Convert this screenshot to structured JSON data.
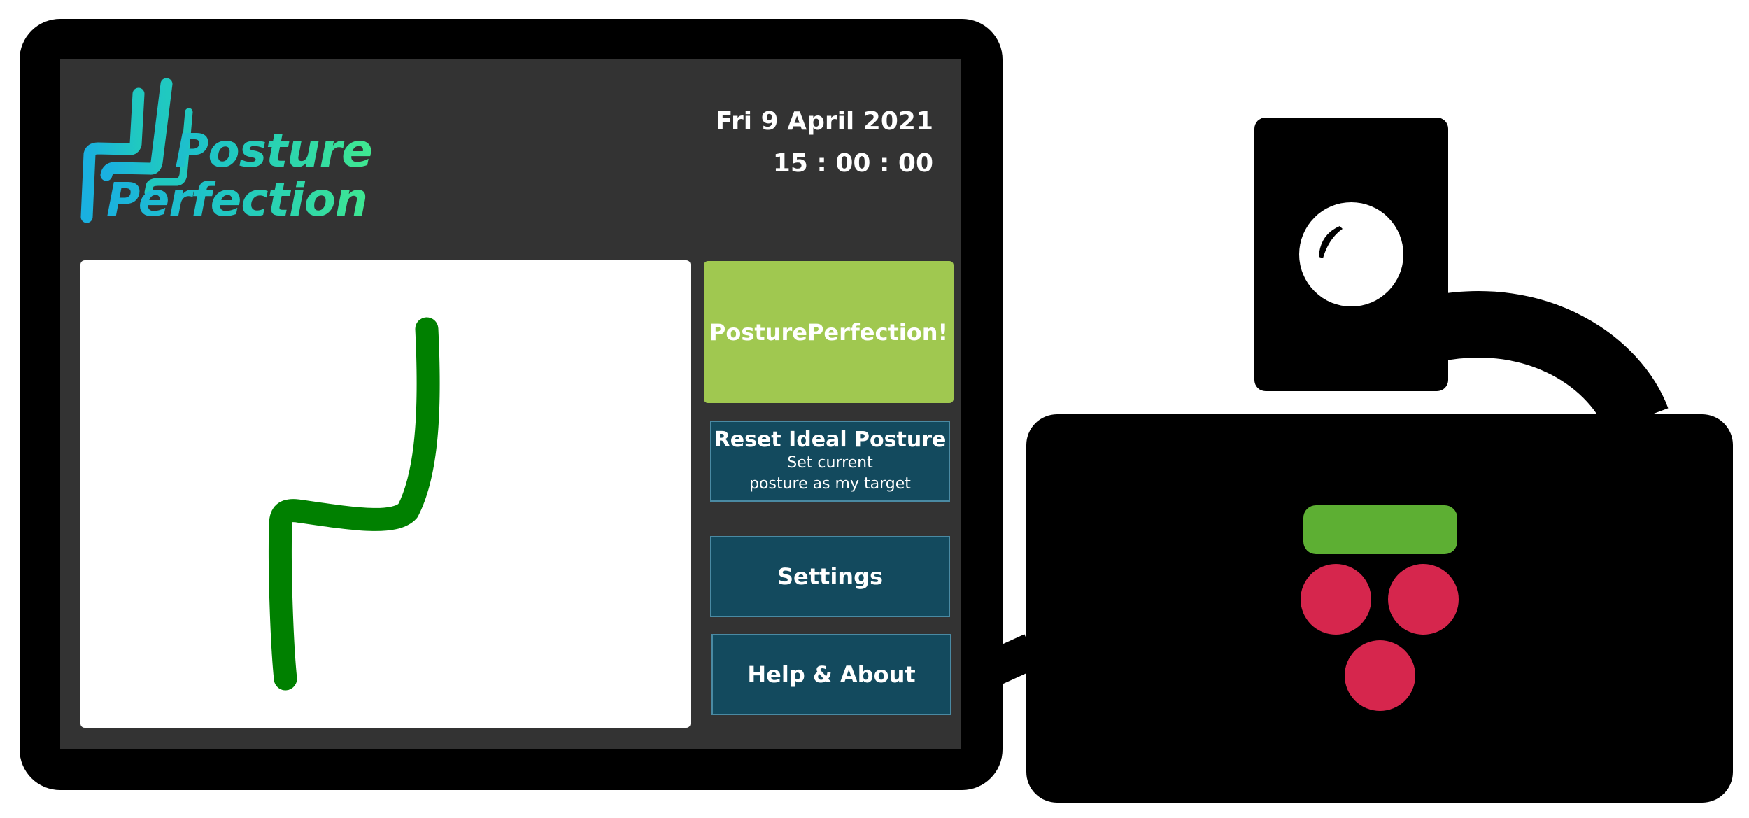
{
  "app": {
    "logo": {
      "line1": "Posture",
      "line2": "Perfection"
    },
    "datetime": {
      "date": "Fri 9 April 2021",
      "time": "15 : 00 : 00"
    }
  },
  "buttons": {
    "main_label": "PosturePerfection!",
    "reset_title": "Reset Ideal Posture",
    "reset_sub_line1": "Set current",
    "reset_sub_line2": "posture as my target",
    "settings_label": "Settings",
    "help_label": "Help & About"
  },
  "colors": {
    "screen_bg": "#333333",
    "accent_green": "#a0c850",
    "button_dark": "#134a5e",
    "posture_line": "#008000",
    "logo_gradient_start": "#1ab0e0",
    "logo_gradient_end": "#40e890",
    "pi_logo_green": "#5daf33",
    "pi_logo_red": "#d6264d"
  },
  "icons": {
    "posture": "posture-spine-line",
    "logo_mark": "chair-outline-logo",
    "camera": "camera-lens",
    "raspberry": "raspberry-pi-logo"
  }
}
